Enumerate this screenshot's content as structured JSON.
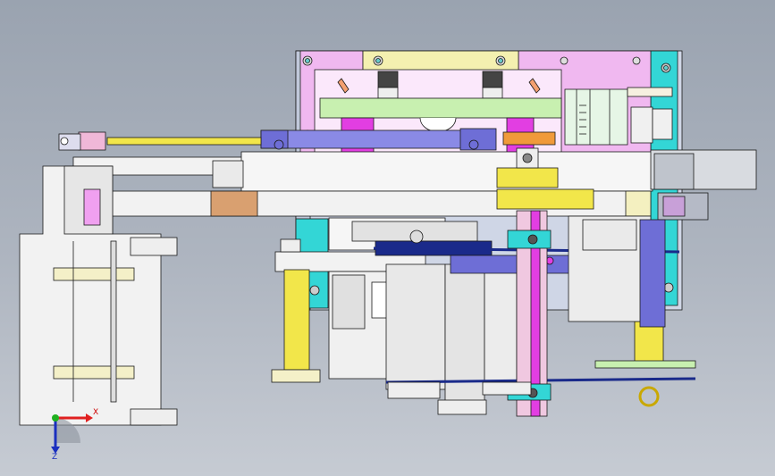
{
  "viewport": {
    "background_top": "#9aa3b0",
    "background_bottom": "#c6cbd3",
    "outline_color": "#1a1a1a"
  },
  "model": {
    "part_colors": {
      "plate_frame": "#cfd6e6",
      "plate_pink": "#f0b8f0",
      "plate_yellow": "#f4f0b0",
      "cyan": "#33d6d6",
      "magenta": "#e23ee2",
      "yellow": "#f2e64a",
      "blue_violet": "#6e6ed6",
      "orange": "#f09a3a",
      "green_light": "#c8f0b0",
      "tan": "#d9a070",
      "grey_light": "#eeeeee",
      "navy": "#1a2a8a"
    }
  },
  "triad": {
    "x_label": "X",
    "z_label": "Z",
    "x_color": "#e02020",
    "z_color": "#1a2fbf",
    "origin_color": "#20b020"
  }
}
